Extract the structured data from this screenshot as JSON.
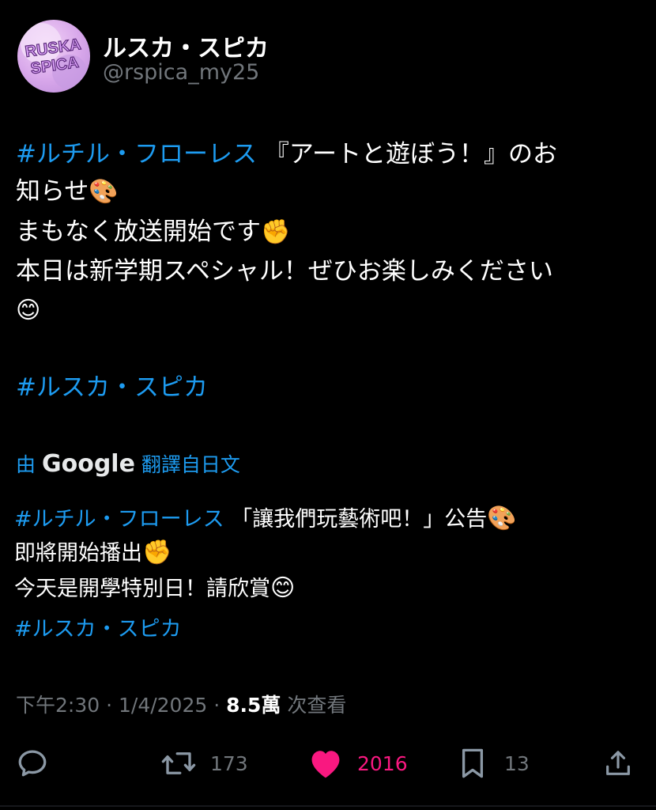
{
  "author": {
    "display_name": "ルスカ・スピカ",
    "handle": "@rspica_my25",
    "avatar_text_top": "RUSKA",
    "avatar_text_bottom": "SPICA"
  },
  "tweet": {
    "hashtag_1": "#ルチル・フローレス",
    "line1_rest": " 『アートと遊ぼう！』のお",
    "line2": "知らせ",
    "line3": "まもなく放送開始です",
    "line4": "本日は新学期スペシャル！ぜひお楽しみください",
    "hashtag_2": "#ルスカ・スピカ",
    "emoji_palette": "🎨",
    "emoji_fist": "✊",
    "emoji_smile": "😊"
  },
  "translation": {
    "prefix": "由",
    "provider": "Google",
    "suffix": "翻譯自日文",
    "hashtag_1": "#ルチル・フローレス",
    "line1_rest": " 「讓我們玩藝術吧！」公告",
    "line2": "即將開始播出",
    "line3": "今天是開學特別日！請欣賞",
    "hashtag_2": "#ルスカ・スピカ"
  },
  "meta": {
    "time": "下午2:30",
    "separator": " · ",
    "date": "1/4/2025",
    "views_count": "8.5萬",
    "views_label": " 次查看"
  },
  "actions": {
    "reply_icon": "reply-icon",
    "retweet_count": "173",
    "like_count": "2016",
    "bookmark_count": "13",
    "share_icon": "share-icon",
    "like_color": "#f91880",
    "link_color": "#1d9bf0"
  }
}
